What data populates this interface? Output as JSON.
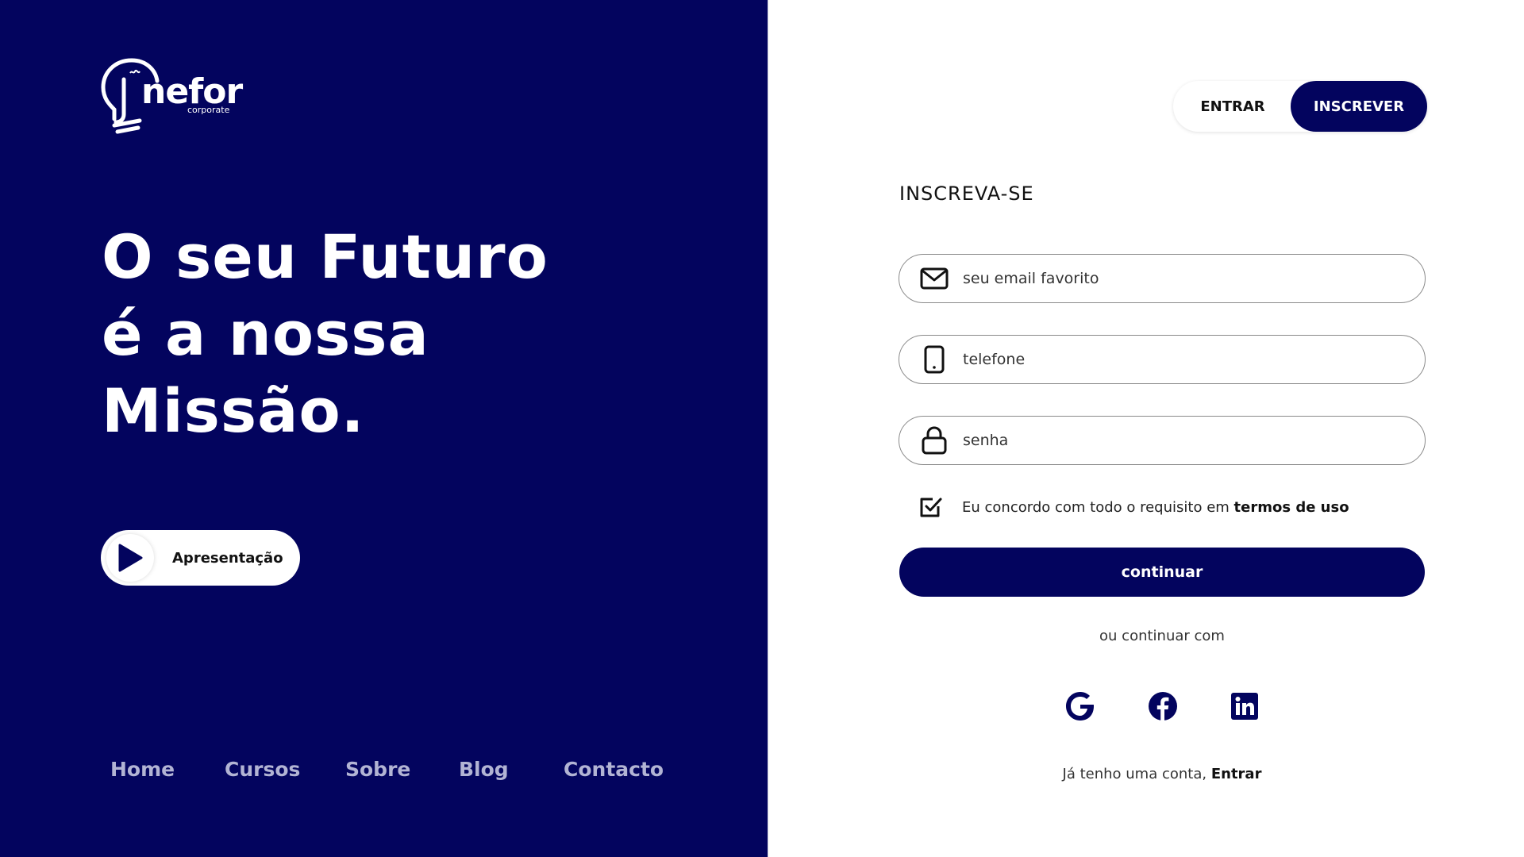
{
  "brand": {
    "logo_word": "nefor",
    "logo_sub": "corporate"
  },
  "hero": {
    "line1": "O seu Futuro",
    "line2": "é a nossa",
    "line3": "Missão."
  },
  "video_button": {
    "label": "Apresentação"
  },
  "footer_nav": [
    {
      "label": "Home"
    },
    {
      "label": "Cursos"
    },
    {
      "label": "Sobre"
    },
    {
      "label": "Blog"
    },
    {
      "label": "Contacto"
    }
  ],
  "auth_toggle": {
    "login": "ENTRAR",
    "signup": "INSCREVER",
    "active": "signup"
  },
  "form": {
    "title": "INSCREVA-SE",
    "email_placeholder": "seu email favorito",
    "phone_placeholder": "telefone",
    "password_placeholder": "senha",
    "agree_text": "Eu concordo com todo o requisito em ",
    "agree_link": "termos de uso",
    "agree_checked": true,
    "submit": "continuar",
    "or_text": "ou continuar com",
    "social": [
      "google-icon",
      "facebook-icon",
      "linkedin-icon"
    ],
    "have_account_text": "Já tenho uma conta, ",
    "have_account_link": "Entrar"
  },
  "colors": {
    "primary": "#03045e",
    "nav_text": "#b2b4d4",
    "white": "#ffffff"
  }
}
